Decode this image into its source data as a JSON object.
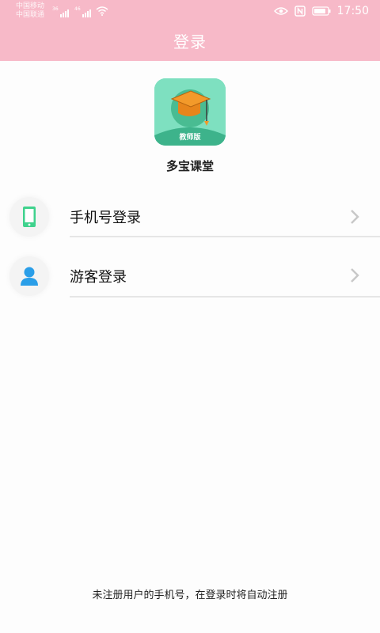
{
  "status_bar": {
    "carrier_1": "中国移动",
    "carrier_2": "中国联通",
    "network_1": "36",
    "network_2": "46",
    "time": "17:50"
  },
  "header": {
    "title": "登录"
  },
  "app": {
    "name": "多宝课堂",
    "logo_badge": "教师版"
  },
  "login_options": [
    {
      "label": "手机号登录",
      "icon": "phone-icon"
    },
    {
      "label": "游客登录",
      "icon": "user-icon"
    }
  ],
  "footer": {
    "note": "未注册用户的手机号，在登录时将自动注册"
  },
  "colors": {
    "header": "#f7b9c8",
    "logo_bg": "#7ee0c0",
    "cap": "#f39a2a",
    "phone": "#3fd28d",
    "user": "#2a9ee8"
  }
}
